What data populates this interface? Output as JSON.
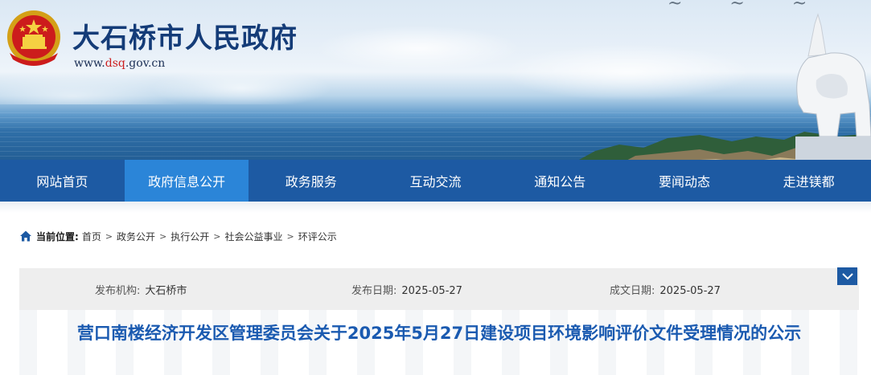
{
  "header": {
    "site_title": "大石桥市人民政府",
    "url_prefix": "www.",
    "url_highlight": "dsq",
    "url_suffix": ".gov.cn",
    "emblem_icon": "national-emblem-icon",
    "colors": {
      "title": "#143c78",
      "url_highlight": "#cc1f1f"
    }
  },
  "nav": {
    "items": [
      {
        "label": "网站首页",
        "active": false
      },
      {
        "label": "政府信息公开",
        "active": true
      },
      {
        "label": "政务服务",
        "active": false
      },
      {
        "label": "互动交流",
        "active": false
      },
      {
        "label": "通知公告",
        "active": false
      },
      {
        "label": "要闻动态",
        "active": false
      },
      {
        "label": "走进镁都",
        "active": false
      }
    ],
    "colors": {
      "bar": "#1d5aa3",
      "active": "#2b85d8"
    }
  },
  "breadcrumb": {
    "label": "当前位置:",
    "home_icon": "home-icon",
    "items": [
      "首页",
      "政务公开",
      "执行公开",
      "社会公益事业",
      "环评公示"
    ],
    "separator": ">"
  },
  "meta": {
    "publisher_key": "发布机构:",
    "publisher_value": "大石桥市",
    "publish_date_key": "发布日期:",
    "publish_date_value": "2025-05-27",
    "created_date_key": "成文日期:",
    "created_date_value": "2025-05-27",
    "toggle_icon": "chevron-down-icon"
  },
  "article": {
    "title": "营口南楼经济开发区管理委员会关于2025年5月27日建设项目环境影响评价文件受理情况的公示",
    "title_color": "#1a5ab0"
  }
}
